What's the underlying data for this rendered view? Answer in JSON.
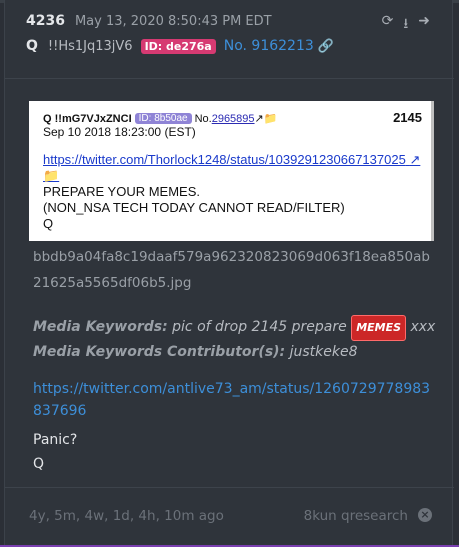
{
  "post": {
    "number": "4236",
    "date": "May 13, 2020 8:50:43 PM EDT",
    "name": "Q",
    "tripcode": "!!Hs1Jq13jV6",
    "id": "ID: de276a",
    "no": "No. 9162213"
  },
  "image": {
    "tripcode": "Q !!mG7VJxZNCI",
    "id": "ID: 8b50ae",
    "no_label": "No.",
    "no_value": "2965895",
    "drop": "2145",
    "timestamp": "Sep 10 2018 18:23:00 (EST)",
    "url": "https://twitter.com/Thorlock1248/status/1039291230667137025",
    "line1": "PREPARE YOUR MEMES.",
    "line2": "(NON_NSA TECH TODAY CANNOT READ/FILTER)",
    "line3": "Q"
  },
  "filename": "bbdb9a04fa8c19daaf579a962320823069d063f18ea850ab21625a5565df06b5.jpg",
  "keywords": {
    "label": "Media Keywords:",
    "value_prefix": "pic of drop 2145 prepare",
    "badge": "MEMES",
    "value_suffix": "xxx",
    "contrib_label": "Media Keywords Contributor(s):",
    "contrib_value": "justkeke8"
  },
  "tweet_url": "https://twitter.com/antlive73_am/status/1260729778983837696",
  "body_lines": [
    "Panic?",
    "Q"
  ],
  "footer": {
    "ago": "4y, 5m, 4w, 1d, 4h, 10m ago",
    "site": "8kun qresearch"
  }
}
